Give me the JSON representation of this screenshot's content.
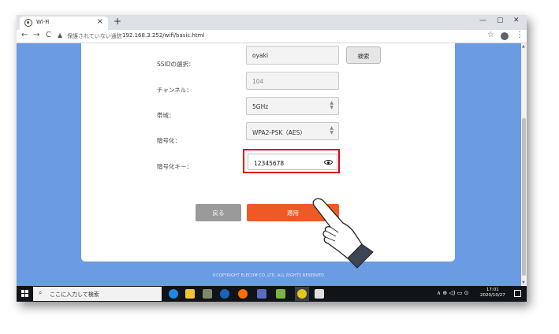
{
  "browser": {
    "tab_title": "Wi-Fi",
    "tab_close": "×",
    "new_tab": "+",
    "win_minimize": "—",
    "win_maximize": "▢",
    "win_close": "✕",
    "back": "←",
    "forward": "→",
    "reload": "C",
    "security_label": "保護されていない通信",
    "url": "192.168.3.252/wifi/basic.html",
    "star": "☆",
    "kebab": "⋮"
  },
  "form": {
    "ssid_label": "SSIDの選択：",
    "ssid_value": "oyaki",
    "search_button": "検索",
    "channel_label": "チャンネル：",
    "channel_value": "104",
    "band_label": "帯域：",
    "band_value": "5GHz",
    "encryption_label": "暗号化：",
    "encryption_value": "WPA2-PSK（AES）",
    "key_label": "暗号化キー：",
    "key_value": "12345678",
    "back_button": "戻る",
    "apply_button": "適用",
    "updown": "▲▼"
  },
  "footer": {
    "copyright": "©COPYRIGHT ELECOM CO.,LTD. ALL RIGHTS RESERVED."
  },
  "taskbar": {
    "search_placeholder": "ここに入力して検索",
    "search_icon": "⌕",
    "tray_icons": "∧ ⊕ ◁) ▭ ⊙",
    "time": "17:01",
    "date": "2020/10/27"
  },
  "colors": {
    "page_bg": "#6a9be3",
    "apply": "#ee5a24",
    "back": "#9a9a9a",
    "highlight": "#e0001b"
  }
}
